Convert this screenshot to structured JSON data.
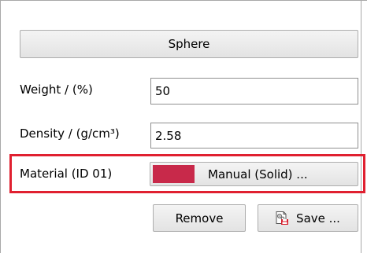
{
  "panel": {
    "shape_button": "Sphere",
    "weight": {
      "label": "Weight / (%)",
      "value": "50"
    },
    "density": {
      "label": "Density / (g/cm³)",
      "value": "2.58"
    },
    "material": {
      "label": "Material (ID 01)",
      "button_label": "Manual (Solid) ...",
      "color": "#c8294a"
    },
    "remove_button": "Remove",
    "save_button": "Save ...",
    "save_icon": "save-settings-icon",
    "highlight_color": "#e02030"
  }
}
